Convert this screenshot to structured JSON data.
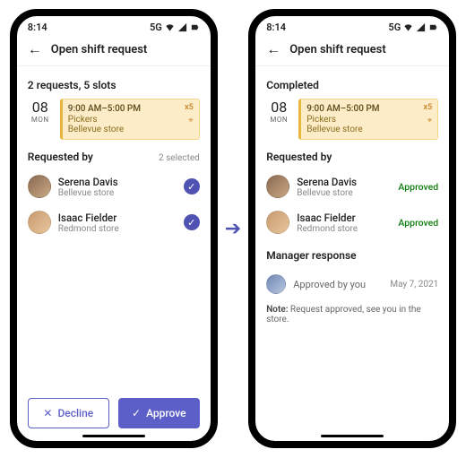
{
  "status": {
    "time": "8:14",
    "net": "5G"
  },
  "appbar": {
    "title": "Open shift request"
  },
  "left": {
    "summary": "2 requests, 5 slots",
    "date": {
      "num": "08",
      "dow": "MON"
    },
    "shift": {
      "time": "9:00 AM–5:00 PM",
      "role": "Pickers",
      "store": "Bellevue store",
      "badge": "x5"
    },
    "req_label": "Requested by",
    "selected_label": "2 selected",
    "people": [
      {
        "name": "Serena Davis",
        "sub": "Bellevue store"
      },
      {
        "name": "Isaac Fielder",
        "sub": "Redmond store"
      }
    ],
    "decline": "Decline",
    "approve": "Approve"
  },
  "right": {
    "summary": "Completed",
    "date": {
      "num": "08",
      "dow": "MON"
    },
    "shift": {
      "time": "9:00 AM–5:00 PM",
      "role": "Pickers",
      "store": "Bellevue store",
      "badge": "x5"
    },
    "req_label": "Requested by",
    "approved": "Approved",
    "people": [
      {
        "name": "Serena Davis",
        "sub": "Bellevue store"
      },
      {
        "name": "Isaac Fielder",
        "sub": "Redmond store"
      }
    ],
    "mgr_label": "Manager response",
    "mgr_text": "Approved by you",
    "mgr_date": "May 7, 2021",
    "note_label": "Note:",
    "note_text": " Request approved, see you in the store."
  }
}
